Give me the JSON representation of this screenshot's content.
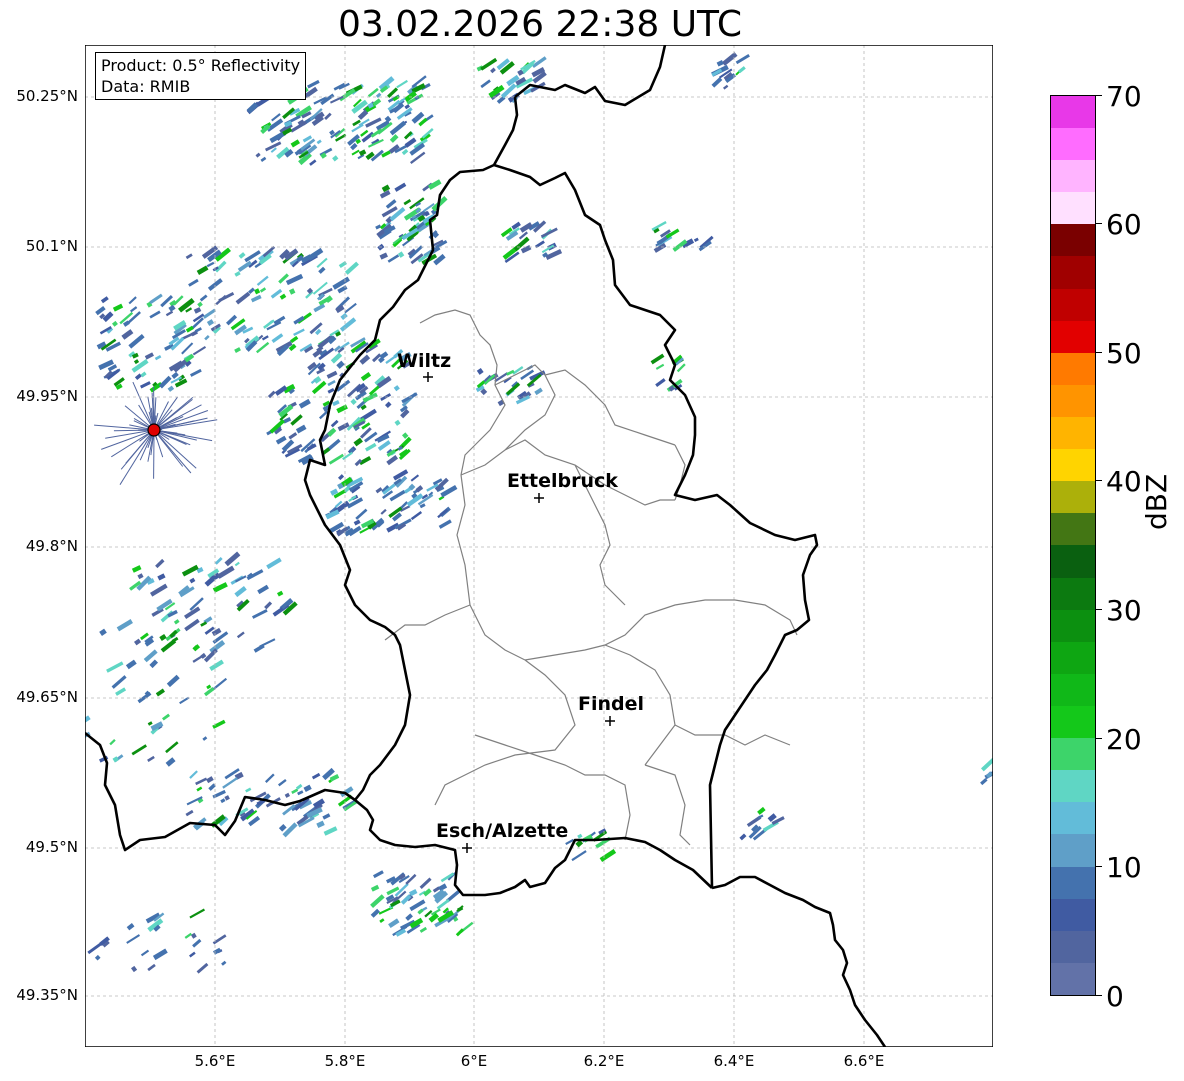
{
  "title": "03.02.2026 22:38 UTC",
  "info": {
    "product": "Product: 0.5° Reflectivity",
    "data": "Data: RMIB"
  },
  "lat_labels": [
    "50.25°N",
    "50.1°N",
    "49.95°N",
    "49.8°N",
    "49.65°N",
    "49.5°N",
    "49.35°N"
  ],
  "lon_labels": [
    "5.6°E",
    "5.8°E",
    "6°E",
    "6.2°E",
    "6.4°E",
    "6.6°E"
  ],
  "cities": [
    {
      "name": "Wiltz"
    },
    {
      "name": "Ettelbruck"
    },
    {
      "name": "Findel"
    },
    {
      "name": "Esch/Alzette"
    }
  ],
  "colorbar": {
    "unit": "dBZ",
    "ticks": [
      "0",
      "10",
      "20",
      "30",
      "40",
      "50",
      "60",
      "70"
    ],
    "range": [
      0,
      70
    ],
    "colors": [
      "#6272a8",
      "#51659f",
      "#405ba2",
      "#4472ae",
      "#5f9fc8",
      "#62bcd9",
      "#5fd6c4",
      "#3dd46a",
      "#14c81a",
      "#10b818",
      "#0ea612",
      "#0c9010",
      "#0c7a10",
      "#0a6010",
      "#437614",
      "#acb00a",
      "#ffd400",
      "#ffb400",
      "#ff9400",
      "#ff7a00",
      "#e20000",
      "#c00000",
      "#a00000",
      "#7a0000",
      "#ffe0ff",
      "#ffb4ff",
      "#ff6cff",
      "#e838e8"
    ]
  },
  "radar_site": {
    "color": "#e00000"
  }
}
